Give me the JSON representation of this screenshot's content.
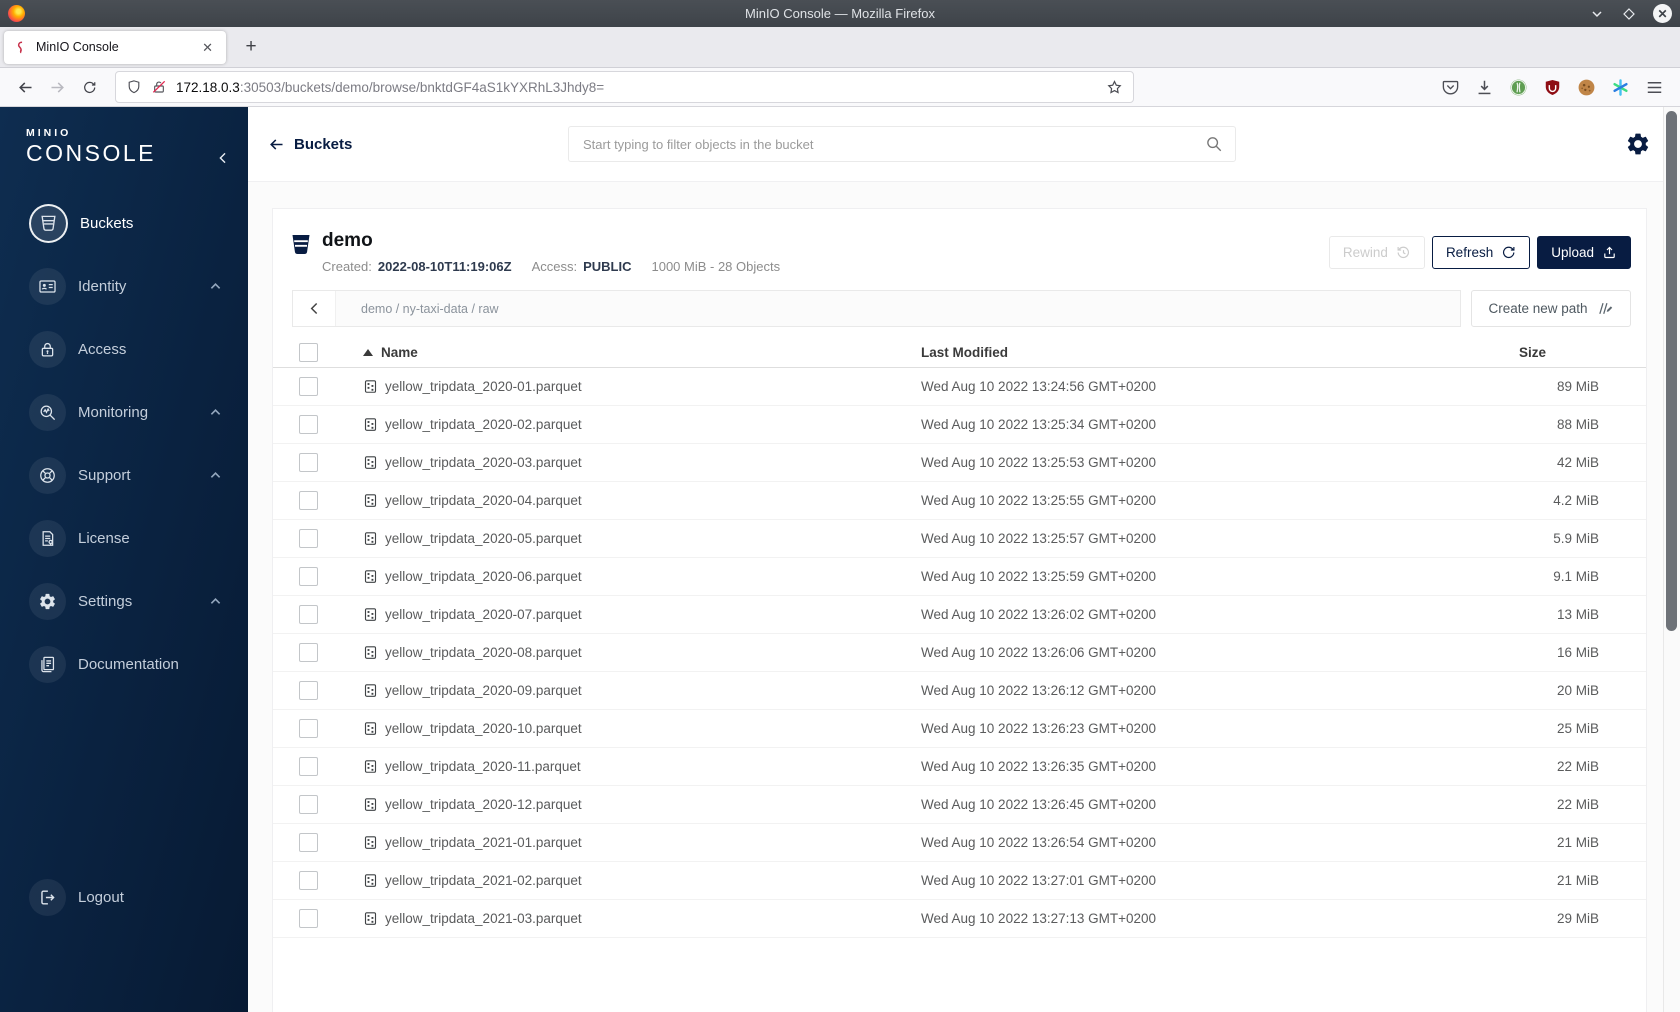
{
  "window": {
    "title": "MinIO Console — Mozilla Firefox"
  },
  "browser": {
    "tab_title": "MinIO Console",
    "url_host": "172.18.0.3",
    "url_rest": ":30503/buckets/demo/browse/bnktdGF4aS1kYXRhL3Jhdy8=",
    "toolbar_icons": [
      "shield-icon",
      "lock-slash-icon",
      "bookmark-star-icon",
      "pocket-icon",
      "download-icon",
      "extension-green-icon",
      "extension-ublock-icon",
      "extension-cookie-icon",
      "extension-asterisk-icon",
      "menu-hamburger-icon"
    ]
  },
  "sidebar": {
    "logo_line1": "MINIO",
    "logo_line2": "CONSOLE",
    "items": [
      {
        "label": "Buckets",
        "icon": "bucket-icon",
        "active": true,
        "expandable": false
      },
      {
        "label": "Identity",
        "icon": "identity-icon",
        "active": false,
        "expandable": true
      },
      {
        "label": "Access",
        "icon": "access-lock-icon",
        "active": false,
        "expandable": false
      },
      {
        "label": "Monitoring",
        "icon": "monitoring-icon",
        "active": false,
        "expandable": true
      },
      {
        "label": "Support",
        "icon": "support-icon",
        "active": false,
        "expandable": true
      },
      {
        "label": "License",
        "icon": "license-icon",
        "active": false,
        "expandable": false
      },
      {
        "label": "Settings",
        "icon": "gear-icon",
        "active": false,
        "expandable": true
      },
      {
        "label": "Documentation",
        "icon": "documentation-icon",
        "active": false,
        "expandable": false
      }
    ],
    "logout_label": "Logout"
  },
  "header": {
    "back_label": "Buckets",
    "search_placeholder": "Start typing to filter objects in the bucket"
  },
  "bucket": {
    "name": "demo",
    "created_label": "Created:",
    "created_value": "2022-08-10T11:19:06Z",
    "access_label": "Access:",
    "access_value": "PUBLIC",
    "usage": "1000 MiB - 28 Objects",
    "rewind_label": "Rewind",
    "refresh_label": "Refresh",
    "upload_label": "Upload"
  },
  "browse": {
    "breadcrumb": [
      "demo",
      "ny-taxi-data",
      "raw"
    ],
    "create_path_label": "Create new path"
  },
  "table": {
    "columns": [
      "Name",
      "Last Modified",
      "Size"
    ],
    "rows": [
      {
        "name": "yellow_tripdata_2020-01.parquet",
        "modified": "Wed Aug 10 2022 13:24:56 GMT+0200",
        "size": "89 MiB"
      },
      {
        "name": "yellow_tripdata_2020-02.parquet",
        "modified": "Wed Aug 10 2022 13:25:34 GMT+0200",
        "size": "88 MiB"
      },
      {
        "name": "yellow_tripdata_2020-03.parquet",
        "modified": "Wed Aug 10 2022 13:25:53 GMT+0200",
        "size": "42 MiB"
      },
      {
        "name": "yellow_tripdata_2020-04.parquet",
        "modified": "Wed Aug 10 2022 13:25:55 GMT+0200",
        "size": "4.2 MiB"
      },
      {
        "name": "yellow_tripdata_2020-05.parquet",
        "modified": "Wed Aug 10 2022 13:25:57 GMT+0200",
        "size": "5.9 MiB"
      },
      {
        "name": "yellow_tripdata_2020-06.parquet",
        "modified": "Wed Aug 10 2022 13:25:59 GMT+0200",
        "size": "9.1 MiB"
      },
      {
        "name": "yellow_tripdata_2020-07.parquet",
        "modified": "Wed Aug 10 2022 13:26:02 GMT+0200",
        "size": "13 MiB"
      },
      {
        "name": "yellow_tripdata_2020-08.parquet",
        "modified": "Wed Aug 10 2022 13:26:06 GMT+0200",
        "size": "16 MiB"
      },
      {
        "name": "yellow_tripdata_2020-09.parquet",
        "modified": "Wed Aug 10 2022 13:26:12 GMT+0200",
        "size": "20 MiB"
      },
      {
        "name": "yellow_tripdata_2020-10.parquet",
        "modified": "Wed Aug 10 2022 13:26:23 GMT+0200",
        "size": "25 MiB"
      },
      {
        "name": "yellow_tripdata_2020-11.parquet",
        "modified": "Wed Aug 10 2022 13:26:35 GMT+0200",
        "size": "22 MiB"
      },
      {
        "name": "yellow_tripdata_2020-12.parquet",
        "modified": "Wed Aug 10 2022 13:26:45 GMT+0200",
        "size": "22 MiB"
      },
      {
        "name": "yellow_tripdata_2021-01.parquet",
        "modified": "Wed Aug 10 2022 13:26:54 GMT+0200",
        "size": "21 MiB"
      },
      {
        "name": "yellow_tripdata_2021-02.parquet",
        "modified": "Wed Aug 10 2022 13:27:01 GMT+0200",
        "size": "21 MiB"
      },
      {
        "name": "yellow_tripdata_2021-03.parquet",
        "modified": "Wed Aug 10 2022 13:27:13 GMT+0200",
        "size": "29 MiB"
      }
    ]
  },
  "colors": {
    "navy": "#081C42",
    "sidebar_gradient_start": "#0E2D50",
    "sidebar_gradient_end": "#071A33",
    "minio_red": "#C7314A",
    "titlebar": "#3E4349"
  }
}
